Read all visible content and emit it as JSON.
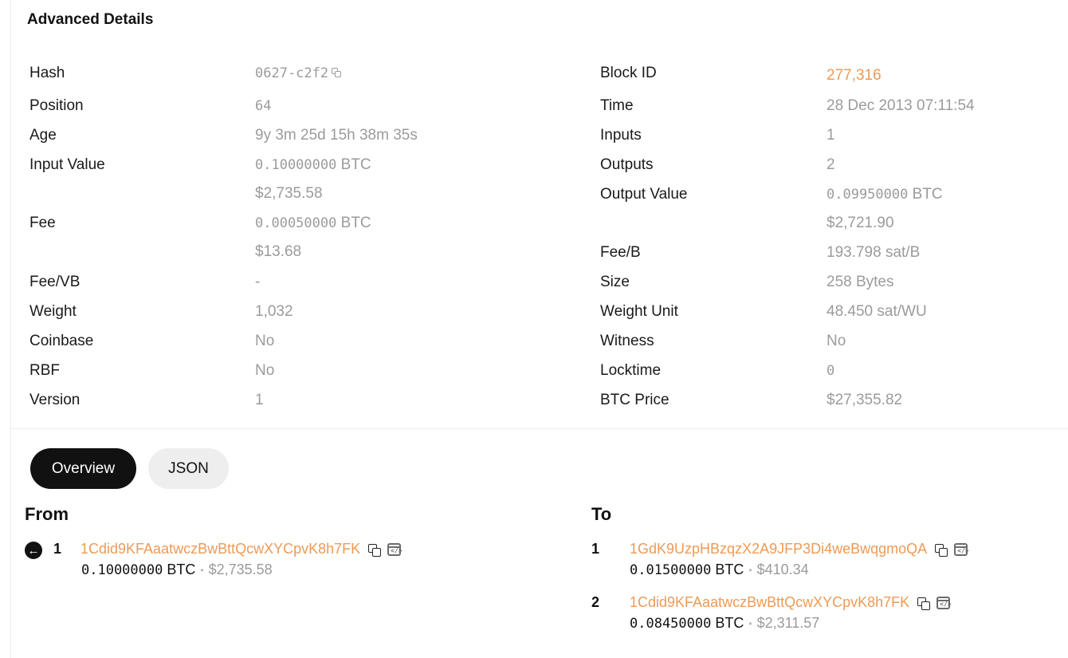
{
  "section_title": "Advanced Details",
  "left_rows": [
    {
      "label": "Hash",
      "value": "0627-c2f2"
    },
    {
      "label": "Position",
      "value": "64"
    },
    {
      "label": "Age",
      "value": "9y 3m 25d 15h 38m 35s"
    },
    {
      "label": "Input Value",
      "value_mono": "0.10000000",
      "value_unit": "BTC",
      "value2": "$2,735.58"
    },
    {
      "label": "Fee",
      "value_mono": "0.00050000",
      "value_unit": "BTC",
      "value2": "$13.68"
    },
    {
      "label": "Fee/VB",
      "value": "-"
    },
    {
      "label": "Weight",
      "value": "1,032"
    },
    {
      "label": "Coinbase",
      "value": "No"
    },
    {
      "label": "RBF",
      "value": "No"
    },
    {
      "label": "Version",
      "value": "1"
    }
  ],
  "right_rows": [
    {
      "label": "Block ID",
      "value": "277,316"
    },
    {
      "label": "Time",
      "value": "28 Dec 2013 07:11:54"
    },
    {
      "label": "Inputs",
      "value": "1"
    },
    {
      "label": "Outputs",
      "value": "2"
    },
    {
      "label": "Output Value",
      "value_mono": "0.09950000",
      "value_unit": "BTC",
      "value2": "$2,721.90"
    },
    {
      "label": "Fee/B",
      "value": "193.798 sat/B"
    },
    {
      "label": "Size",
      "value": "258 Bytes"
    },
    {
      "label": "Weight Unit",
      "value": "48.450 sat/WU"
    },
    {
      "label": "Witness",
      "value": "No"
    },
    {
      "label": "Locktime",
      "value": "0"
    },
    {
      "label": "BTC Price",
      "value": "$27,355.82"
    }
  ],
  "tabs": {
    "overview": "Overview",
    "json": "JSON"
  },
  "from": {
    "title": "From",
    "items": [
      {
        "index": "1",
        "address": "1Cdid9KFAaatwczBwBttQcwXYCpvK8h7FK",
        "btc": "0.10000000",
        "unit": "BTC",
        "bullet": "•",
        "usd": "$2,735.58"
      }
    ]
  },
  "to": {
    "title": "To",
    "items": [
      {
        "index": "1",
        "address": "1GdK9UzpHBzqzX2A9JFP3Di4weBwqgmoQA",
        "btc": "0.01500000",
        "unit": "BTC",
        "bullet": "•",
        "usd": "$410.34"
      },
      {
        "index": "2",
        "address": "1Cdid9KFAaatwczBwBttQcwXYCpvK8h7FK",
        "btc": "0.08450000",
        "unit": "BTC",
        "bullet": "•",
        "usd": "$2,311.57"
      }
    ]
  },
  "icons": {
    "copy": "copy-icon",
    "code": "code-icon",
    "arrow": "arrow-left-circle-icon"
  },
  "code_icon_glyph": "</>",
  "arrow_glyph": "←",
  "colors": {
    "link": "#ee9a55",
    "muted": "#9b9b9b",
    "active_tab": "#111111"
  }
}
